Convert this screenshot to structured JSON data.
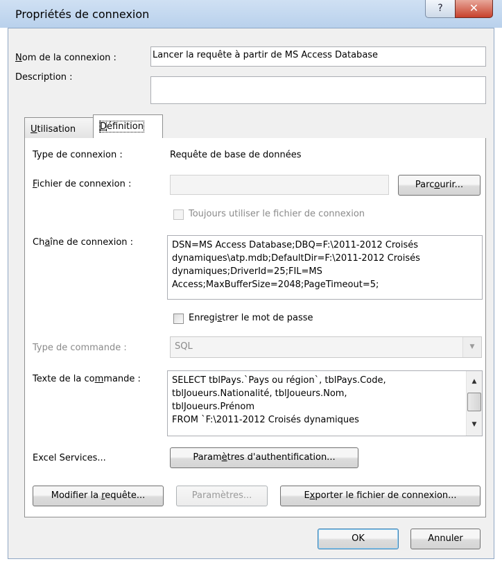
{
  "window": {
    "title": "Propriétés de connexion",
    "help_glyph": "?",
    "close_glyph": "✕"
  },
  "connection_name": {
    "label_pre": "",
    "label_acc": "N",
    "label_post": "om de la connexion :",
    "value": "Lancer la requête à partir de MS Access Database"
  },
  "description": {
    "label": "Description :",
    "value": ""
  },
  "tabs": {
    "usage": {
      "acc": "U",
      "rest": "tilisation"
    },
    "definition": {
      "pre": "",
      "acc": "D",
      "rest": "éfinition"
    }
  },
  "definition": {
    "connection_type": {
      "label": "Type de connexion :",
      "value": "Requête de base de données"
    },
    "connection_file": {
      "label_acc": "F",
      "label_post": "ichier de connexion :",
      "value": "",
      "browse_pre": "Parc",
      "browse_acc": "o",
      "browse_post": "urir..."
    },
    "always_use_file": {
      "label": "Toujours utiliser le fichier de connexion",
      "checked": false
    },
    "connection_string": {
      "label_pre": "Ch",
      "label_acc": "a",
      "label_post": "îne de connexion :",
      "lines": [
        "DSN=MS Access Database;DBQ=F:\\2011-2012 Croisés",
        "dynamiques\\atp.mdb;DefaultDir=F:\\2011-2012 Croisés",
        "dynamiques;DriverId=25;FIL=MS",
        "Access;MaxBufferSize=2048;PageTimeout=5;"
      ]
    },
    "save_password": {
      "label_pre": "Enregi",
      "label_acc": "s",
      "label_post": "trer le mot de passe",
      "checked": false
    },
    "command_type": {
      "label": "Type de commande :",
      "value": "SQL"
    },
    "command_text": {
      "label_pre": "Texte de la co",
      "label_acc": "m",
      "label_post": "mande :",
      "lines": [
        "SELECT tblPays.`Pays ou région`, tblPays.Code,",
        "tblJoueurs.Nationalité, tblJoueurs.Nom,",
        "tblJoueurs.Prénom",
        "FROM `F:\\2011-2012 Croisés dynamiques"
      ]
    },
    "excel_services": {
      "label": "Excel Services...",
      "auth_pre": "Param",
      "auth_acc": "è",
      "auth_post": "tres d'authentification..."
    },
    "buttons": {
      "edit_pre": "Modifier la ",
      "edit_acc": "r",
      "edit_post": "equête...",
      "params": "Paramètres...",
      "export_pre": "E",
      "export_acc": "x",
      "export_post": "porter le fichier de connexion..."
    }
  },
  "footer": {
    "ok": "OK",
    "cancel": "Annuler"
  },
  "colors": {
    "title_bar": "#c4d9f0",
    "close_button": "#c7412c",
    "dialog_face": "#f0f0f0",
    "default_button_border": "#3c7fb1"
  }
}
